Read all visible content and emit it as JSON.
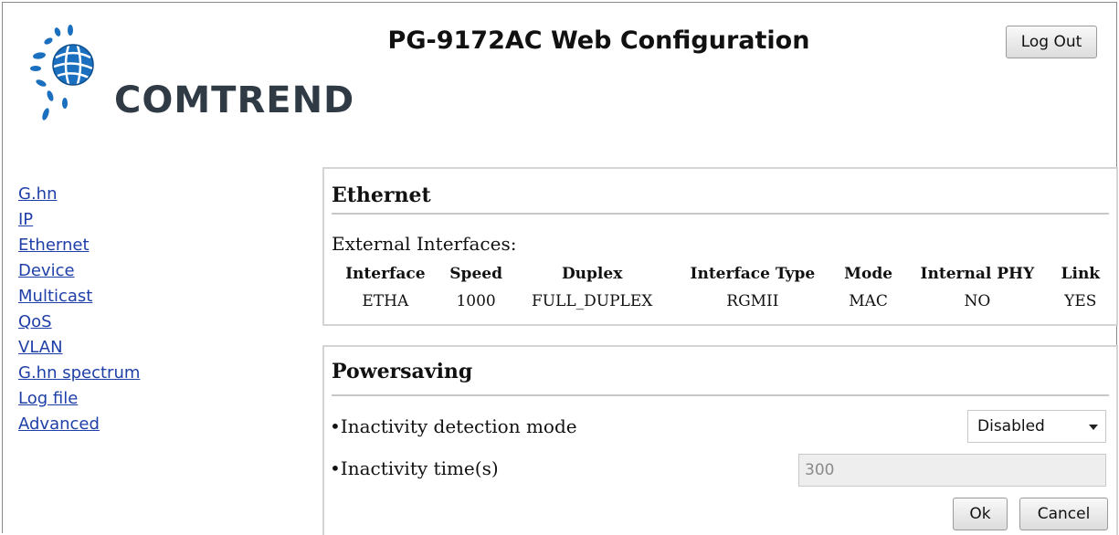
{
  "header": {
    "logo_text": "COMTREND",
    "title": "PG-9172AC Web Configuration",
    "logout_label": "Log Out"
  },
  "sidebar": {
    "items": [
      {
        "label": "G.hn"
      },
      {
        "label": "IP"
      },
      {
        "label": "Ethernet"
      },
      {
        "label": "Device"
      },
      {
        "label": "Multicast"
      },
      {
        "label": "QoS"
      },
      {
        "label": "VLAN"
      },
      {
        "label": "G.hn spectrum"
      },
      {
        "label": "Log file"
      },
      {
        "label": "Advanced"
      }
    ]
  },
  "ethernet": {
    "title": "Ethernet",
    "external_label": "External Interfaces:",
    "columns": [
      "Interface",
      "Speed",
      "Duplex",
      "Interface Type",
      "Mode",
      "Internal PHY",
      "Link"
    ],
    "rows": [
      [
        "ETHA",
        "1000",
        "FULL_DUPLEX",
        "RGMII",
        "MAC",
        "NO",
        "YES"
      ]
    ]
  },
  "powersaving": {
    "title": "Powersaving",
    "detection_label": "•Inactivity detection mode",
    "detection_value": "Disabled",
    "time_label": "•Inactivity time(s)",
    "time_value": "300",
    "ok_label": "Ok",
    "cancel_label": "Cancel"
  },
  "colors": {
    "link": "#1f3fa8",
    "logo_blue": "#1a6fbf",
    "logo_text": "#2f3a45"
  }
}
